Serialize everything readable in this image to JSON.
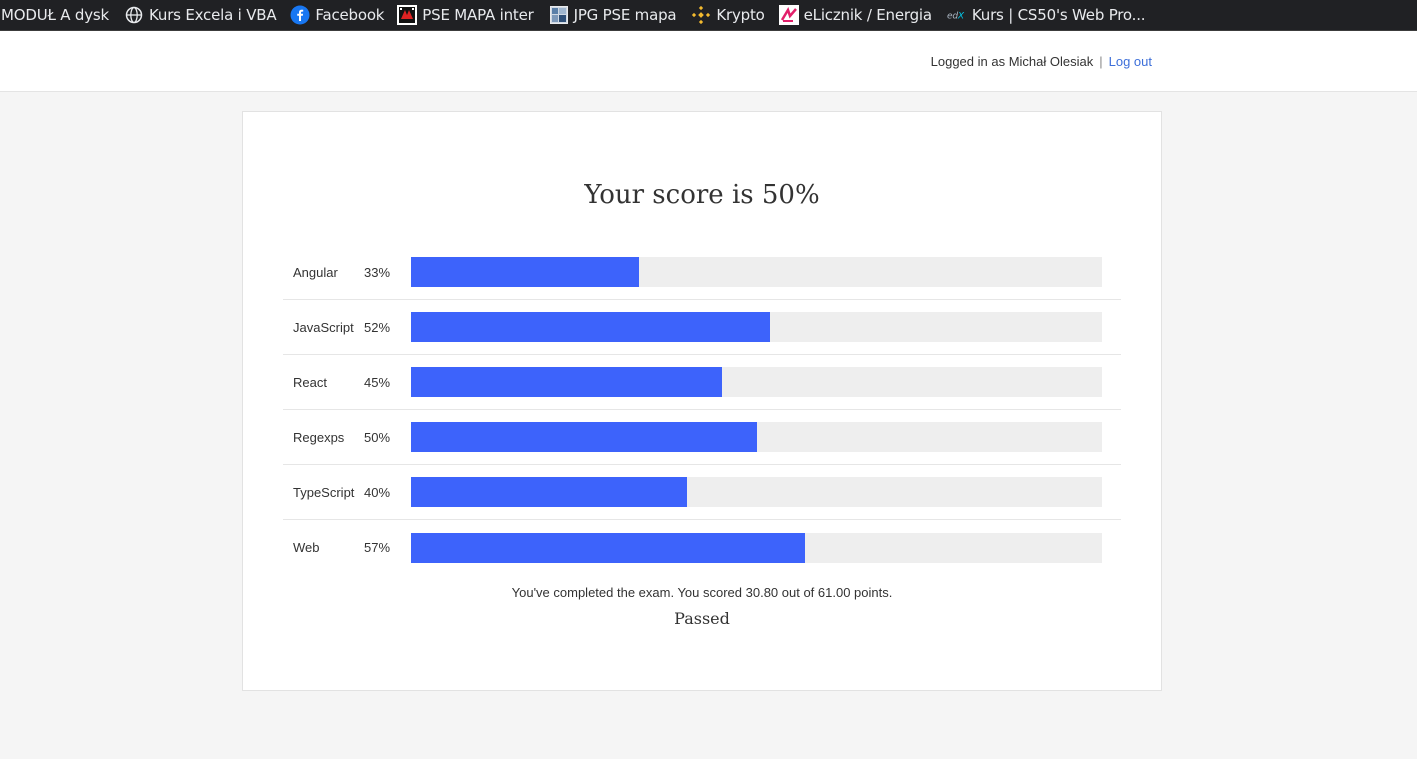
{
  "bookmarks": [
    {
      "label": "MODUŁ A dysk",
      "icon": "none"
    },
    {
      "label": "Kurs Excela i VBA",
      "icon": "globe-icon"
    },
    {
      "label": "Facebook",
      "icon": "facebook-icon"
    },
    {
      "label": "PSE MAPA inter",
      "icon": "pse-map-icon"
    },
    {
      "label": "JPG PSE mapa",
      "icon": "image-icon"
    },
    {
      "label": "Krypto",
      "icon": "binance-icon"
    },
    {
      "label": "eLicznik / Energia",
      "icon": "elicznik-icon"
    },
    {
      "label": "Kurs | CS50's Web Pro...",
      "icon": "edx-icon"
    }
  ],
  "header": {
    "logged_in_text": "Logged in as Michał Olesiak",
    "separator": "|",
    "logout_label": "Log out"
  },
  "results": {
    "title": "Your score is 50%",
    "categories": [
      {
        "name": "Angular",
        "percent_label": "33%",
        "value": 33
      },
      {
        "name": "JavaScript",
        "percent_label": "52%",
        "value": 52
      },
      {
        "name": "React",
        "percent_label": "45%",
        "value": 45
      },
      {
        "name": "Regexps",
        "percent_label": "50%",
        "value": 50
      },
      {
        "name": "TypeScript",
        "percent_label": "40%",
        "value": 40
      },
      {
        "name": "Web",
        "percent_label": "57%",
        "value": 57
      }
    ],
    "summary": "You've completed the exam. You scored 30.80 out of 61.00 points.",
    "status": "Passed"
  },
  "colors": {
    "bar_fill": "#3d63fb",
    "bar_track": "#eeeeee",
    "link": "#3d6fd9"
  }
}
